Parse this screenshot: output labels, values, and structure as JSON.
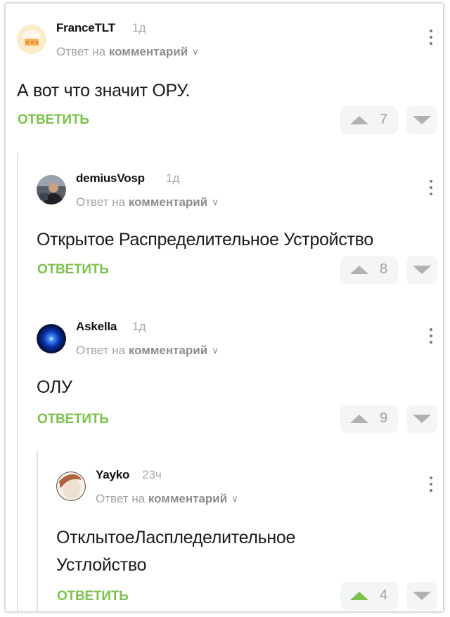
{
  "common": {
    "reply_prefix": "Ответ на",
    "reply_target": "комментарий",
    "reply_button": "ОТВЕТИТЬ"
  },
  "comments": [
    {
      "username": "FranceTLT",
      "time": "1д",
      "text": "А вот что значит ОРУ.",
      "votes": "7",
      "upvoted": false
    },
    {
      "username": "demiusVosp",
      "time": "1д",
      "text": "Открытое Распределительное Устройство",
      "votes": "8",
      "upvoted": false
    },
    {
      "username": "Askella",
      "time": "1д",
      "text": "ОЛУ",
      "votes": "9",
      "upvoted": false
    },
    {
      "username": "Yayko",
      "time": "23ч",
      "text_line1": "ОтклытоеЛаспледелительное",
      "text_line2": "Устлойство",
      "votes": "4",
      "upvoted": true
    }
  ],
  "colors": {
    "accent_green": "#7cc04c",
    "vote_bg": "#f4f5f7",
    "muted_text": "#a3a3a3"
  },
  "icons": [
    "chef-hat-avatar",
    "photo-avatar",
    "blue-orb-avatar",
    "egg-avatar",
    "chevron-down-icon",
    "more-vertical-icon",
    "arrow-up-icon",
    "arrow-down-icon"
  ]
}
